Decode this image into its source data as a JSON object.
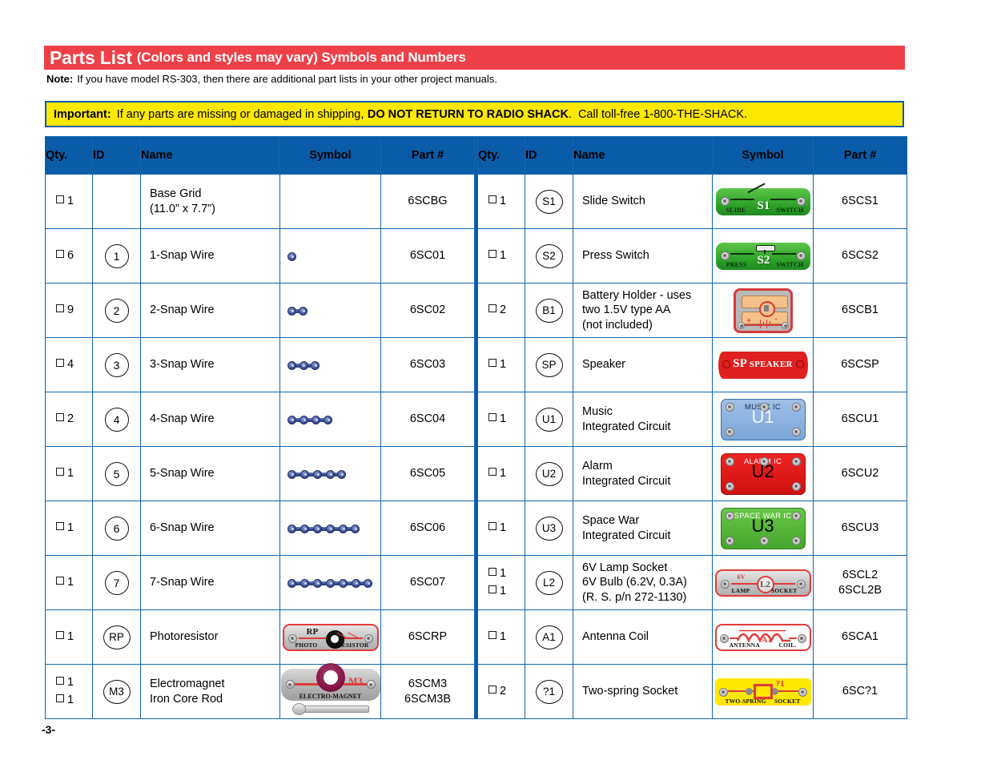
{
  "header": {
    "title_main": "Parts List",
    "title_sub": "(Colors and styles may vary) Symbols and Numbers",
    "note_label": "Note:",
    "note_text": "If you have model RS-303, then there are additional part lists in your other project manuals.",
    "important_label": "Important:",
    "important_text_1": "If any parts are missing or damaged in shipping,",
    "important_strong": "DO NOT RETURN TO RADIO SHACK",
    "important_text_2": ".",
    "important_text_3": "Call toll-free 1-800-THE-SHACK."
  },
  "colors": {
    "banner_red": "#ef4048",
    "table_blue": "#0a5ba8",
    "border_blue": "#1166b0",
    "important_yellow": "#ffe800"
  },
  "table": {
    "columns": [
      "Qty.",
      "ID",
      "Name",
      "Symbol",
      "Part #"
    ],
    "left_rows": [
      {
        "qty": [
          "1"
        ],
        "id": "",
        "name": [
          "Base Grid",
          "(11.0” x 7.7”)"
        ],
        "part": [
          "6SCBG"
        ],
        "symbol": "none"
      },
      {
        "qty": [
          "6"
        ],
        "id": "1",
        "name": [
          "1-Snap Wire"
        ],
        "part": [
          "6SC01"
        ],
        "symbol": "snap-wire-1"
      },
      {
        "qty": [
          "9"
        ],
        "id": "2",
        "name": [
          "2-Snap Wire"
        ],
        "part": [
          "6SC02"
        ],
        "symbol": "snap-wire-2"
      },
      {
        "qty": [
          "4"
        ],
        "id": "3",
        "name": [
          "3-Snap Wire"
        ],
        "part": [
          "6SC03"
        ],
        "symbol": "snap-wire-3"
      },
      {
        "qty": [
          "2"
        ],
        "id": "4",
        "name": [
          "4-Snap Wire"
        ],
        "part": [
          "6SC04"
        ],
        "symbol": "snap-wire-4"
      },
      {
        "qty": [
          "1"
        ],
        "id": "5",
        "name": [
          "5-Snap Wire"
        ],
        "part": [
          "6SC05"
        ],
        "symbol": "snap-wire-5"
      },
      {
        "qty": [
          "1"
        ],
        "id": "6",
        "name": [
          "6-Snap Wire"
        ],
        "part": [
          "6SC06"
        ],
        "symbol": "snap-wire-6"
      },
      {
        "qty": [
          "1"
        ],
        "id": "7",
        "name": [
          "7-Snap Wire"
        ],
        "part": [
          "6SC07"
        ],
        "symbol": "snap-wire-7"
      },
      {
        "qty": [
          "1"
        ],
        "id": "RP",
        "name": [
          "Photoresistor"
        ],
        "part": [
          "6SCRP"
        ],
        "symbol": "photoresistor"
      },
      {
        "qty": [
          "1",
          "1"
        ],
        "id": "M3",
        "name": [
          "Electromagnet",
          "Iron Core Rod"
        ],
        "part": [
          "6SCM3",
          "6SCM3B"
        ],
        "symbol": "electromagnet"
      }
    ],
    "right_rows": [
      {
        "qty": [
          "1"
        ],
        "id": "S1",
        "name": [
          "Slide Switch"
        ],
        "part": [
          "6SCS1"
        ],
        "symbol": "slide-switch"
      },
      {
        "qty": [
          "1"
        ],
        "id": "S2",
        "name": [
          "Press Switch"
        ],
        "part": [
          "6SCS2"
        ],
        "symbol": "press-switch"
      },
      {
        "qty": [
          "2"
        ],
        "id": "B1",
        "name": [
          "Battery Holder - uses",
          "two 1.5V type AA",
          "(not included)"
        ],
        "part": [
          "6SCB1"
        ],
        "symbol": "battery-holder"
      },
      {
        "qty": [
          "1"
        ],
        "id": "SP",
        "name": [
          "Speaker"
        ],
        "part": [
          "6SCSP"
        ],
        "symbol": "speaker"
      },
      {
        "qty": [
          "1"
        ],
        "id": "U1",
        "name": [
          "Music",
          "Integrated Circuit"
        ],
        "part": [
          "6SCU1"
        ],
        "symbol": "music-ic"
      },
      {
        "qty": [
          "1"
        ],
        "id": "U2",
        "name": [
          "Alarm",
          "Integrated Circuit"
        ],
        "part": [
          "6SCU2"
        ],
        "symbol": "alarm-ic"
      },
      {
        "qty": [
          "1"
        ],
        "id": "U3",
        "name": [
          "Space War",
          "Integrated Circuit"
        ],
        "part": [
          "6SCU3"
        ],
        "symbol": "space-war-ic"
      },
      {
        "qty": [
          "1",
          "1"
        ],
        "id": "L2",
        "name": [
          "6V Lamp Socket",
          "6V Bulb (6.2V, 0.3A)",
          "(R. S. p/n 272-1130)"
        ],
        "part": [
          "6SCL2",
          "6SCL2B"
        ],
        "symbol": "lamp-socket"
      },
      {
        "qty": [
          "1"
        ],
        "id": "A1",
        "name": [
          "Antenna Coil"
        ],
        "part": [
          "6SCA1"
        ],
        "symbol": "antenna-coil"
      },
      {
        "qty": [
          "2"
        ],
        "id": "?1",
        "name": [
          "Two-spring Socket"
        ],
        "part": [
          "6SC?1"
        ],
        "symbol": "two-spring-socket"
      }
    ]
  },
  "symbol_labels": {
    "slide_switch": {
      "left": "SLIDE",
      "right": "SWITCH",
      "id": "S1"
    },
    "press_switch": {
      "left": "PRESS",
      "right": "SWITCH",
      "id": "S2"
    },
    "speaker": {
      "id": "SP",
      "text": "SPEAKER"
    },
    "music_ic": {
      "id": "U1",
      "caption": "MUSIC IC"
    },
    "alarm_ic": {
      "id": "U2",
      "caption": "ALARM IC"
    },
    "space_war_ic": {
      "id": "U3",
      "caption": "SPACE WAR IC"
    },
    "lamp_socket": {
      "volts": "6V",
      "left": "LAMP",
      "right": "SOCKET",
      "id": "L2"
    },
    "antenna_coil": {
      "left": "ANTENNA",
      "right": "COIL.",
      "id": "A1"
    },
    "two_spring_socket": {
      "left": "TWO-SPRING",
      "right": "SOCKET",
      "id": "?1"
    },
    "photoresistor": {
      "id": "RP",
      "left": "PHOTO",
      "right": "RESISTOR"
    },
    "electromagnet": {
      "id": "M3",
      "caption": "ELECTRO-MAGNET"
    },
    "battery": {
      "plus": "+",
      "minus": "-"
    }
  },
  "footer": {
    "page_number": "-3-"
  }
}
